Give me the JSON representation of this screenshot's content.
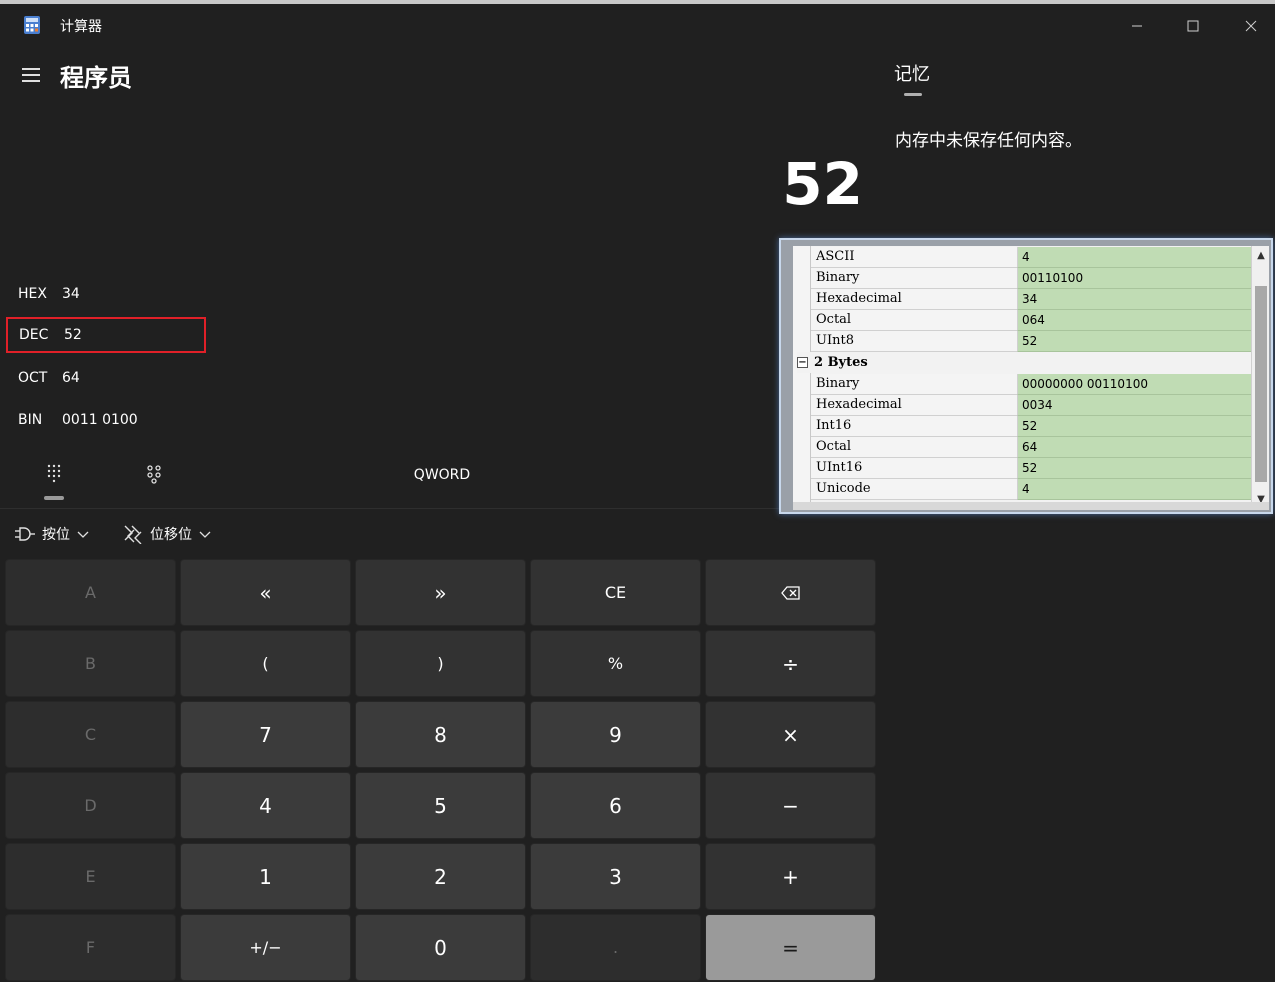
{
  "window": {
    "title": "计算器",
    "minimize_glyph": "—",
    "maximize_glyph": "☐",
    "close_glyph": "✕"
  },
  "header": {
    "mode_title": "程序员"
  },
  "display": {
    "result": "52"
  },
  "radix": {
    "hex": {
      "label": "HEX",
      "value": "34"
    },
    "dec": {
      "label": "DEC",
      "value": "52"
    },
    "oct": {
      "label": "OCT",
      "value": "64"
    },
    "bin": {
      "label": "BIN",
      "value": "0011 0100"
    }
  },
  "word_size": "QWORD",
  "dropdowns": {
    "bitwise": "按位",
    "bitshift": "位移位"
  },
  "keys": {
    "a": "A",
    "lshift": "«",
    "rshift": "»",
    "ce": "CE",
    "backspace": "⌫",
    "b": "B",
    "lparen": "(",
    "rparen": ")",
    "percent": "%",
    "divide": "÷",
    "c": "C",
    "seven": "7",
    "eight": "8",
    "nine": "9",
    "multiply": "×",
    "d": "D",
    "four": "4",
    "five": "5",
    "six": "6",
    "minus": "−",
    "e": "E",
    "one": "1",
    "two": "2",
    "three": "3",
    "plus": "+",
    "f": "F",
    "negate": "+/−",
    "zero": "0",
    "decimal": ".",
    "equals": "="
  },
  "memory": {
    "tab_label": "记忆",
    "empty_message": "内存中未保存任何内容。"
  },
  "inspector": {
    "rows_1byte": [
      {
        "key": "ASCII",
        "value": "4"
      },
      {
        "key": "Binary",
        "value": "00110100"
      },
      {
        "key": "Hexadecimal",
        "value": "34"
      },
      {
        "key": "Octal",
        "value": "064"
      },
      {
        "key": "UInt8",
        "value": "52"
      }
    ],
    "group_2bytes": "2 Bytes",
    "group_toggle": "−",
    "rows_2bytes": [
      {
        "key": "Binary",
        "value": "00000000 00110100"
      },
      {
        "key": "Hexadecimal",
        "value": "0034"
      },
      {
        "key": "Int16",
        "value": "52"
      },
      {
        "key": "Octal",
        "value": "64"
      },
      {
        "key": "UInt16",
        "value": "52"
      },
      {
        "key": "Unicode",
        "value": "4"
      }
    ],
    "scroll_up": "▲",
    "scroll_down": "▼"
  },
  "colors": {
    "background": "#202020",
    "selection_border": "#e02028",
    "equals_key": "#9a9a9a",
    "inspector_value_bg": "#c0dcb4"
  }
}
